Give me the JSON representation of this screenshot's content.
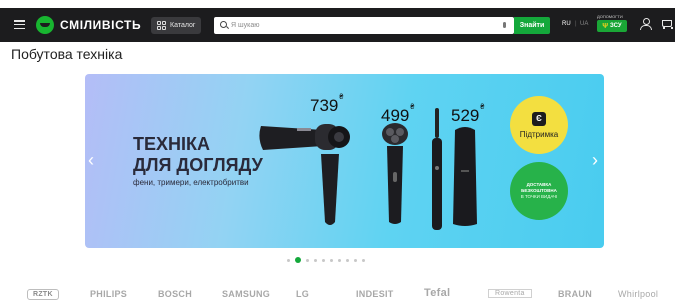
{
  "header": {
    "logo_text": "СМІЛИВІСТЬ",
    "catalog_label": "Каталог",
    "search_placeholder": "Я шукаю",
    "find_label": "Знайти",
    "lang_active": "RU",
    "lang_separator": "|",
    "lang_inactive": "UA",
    "support_label": "ДОПОМОГТИ",
    "zsu_label": "ЗСУ",
    "accent_color": "#14a83b"
  },
  "page": {
    "title": "Побутова техніка"
  },
  "banner": {
    "title_line1": "ТЕХНІКА",
    "title_line2": "ДЛЯ ДОГЛЯДУ",
    "subtitle": "фени, тримери, електробритви",
    "prices": [
      {
        "value": "739",
        "currency": "₴"
      },
      {
        "value": "499",
        "currency": "₴"
      },
      {
        "value": "529",
        "currency": "₴"
      }
    ],
    "support_badge": {
      "icon_letter": "Є",
      "label": "Підтримка"
    },
    "delivery_badge": {
      "line1": "ДОСТАВКА",
      "line2": "БЕЗКОШТОВНА",
      "line3": "В ТОЧКИ ВИДАЧІ"
    },
    "background_colors": [
      "#b4bdf7",
      "#49ccef"
    ]
  },
  "carousel": {
    "slide_count": 10,
    "active_index": 1
  },
  "brands": [
    "RZTK",
    "PHILIPS",
    "BOSCH",
    "SAMSUNG",
    "LG",
    "INDESIT",
    "Tefal",
    "Rowenta",
    "BRAUN",
    "Whirlpool"
  ]
}
